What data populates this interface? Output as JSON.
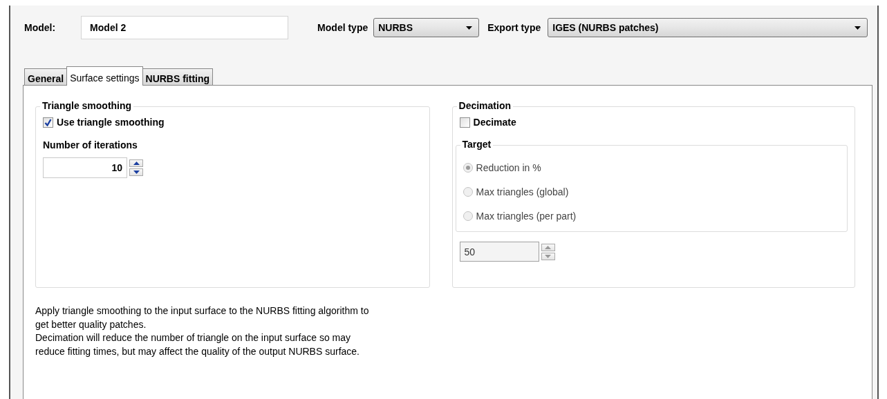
{
  "header": {
    "model_label": "Model:",
    "model_value": "Model 2",
    "model_type_label": "Model type",
    "model_type_value": "NURBS",
    "export_type_label": "Export type",
    "export_type_value": "IGES (NURBS patches)"
  },
  "tabs": [
    {
      "label": "General",
      "selected": false
    },
    {
      "label": "Surface settings",
      "selected": true
    },
    {
      "label": "NURBS fitting",
      "selected": false
    }
  ],
  "triangle_smoothing": {
    "title": "Triangle smoothing",
    "checkbox": {
      "label": "Use triangle smoothing",
      "checked": true
    },
    "iterations_label": "Number of iterations",
    "iterations_value": "10"
  },
  "decimation": {
    "title": "Decimation",
    "checkbox": {
      "label": "Decimate",
      "checked": false
    },
    "target": {
      "title": "Target",
      "disabled": true,
      "options": [
        {
          "label": "Reduction in %",
          "selected": true
        },
        {
          "label": "Max triangles (global)",
          "selected": false
        },
        {
          "label": "Max triangles (per part)",
          "selected": false
        }
      ]
    },
    "value": "50",
    "value_disabled": true
  },
  "description": [
    "Apply triangle smoothing to the input surface to the NURBS fitting algorithm to get better quality patches.",
    "Decimation will reduce the number of triangle on the input surface so may reduce fitting times, but may affect the quality of the output NURBS surface."
  ]
}
